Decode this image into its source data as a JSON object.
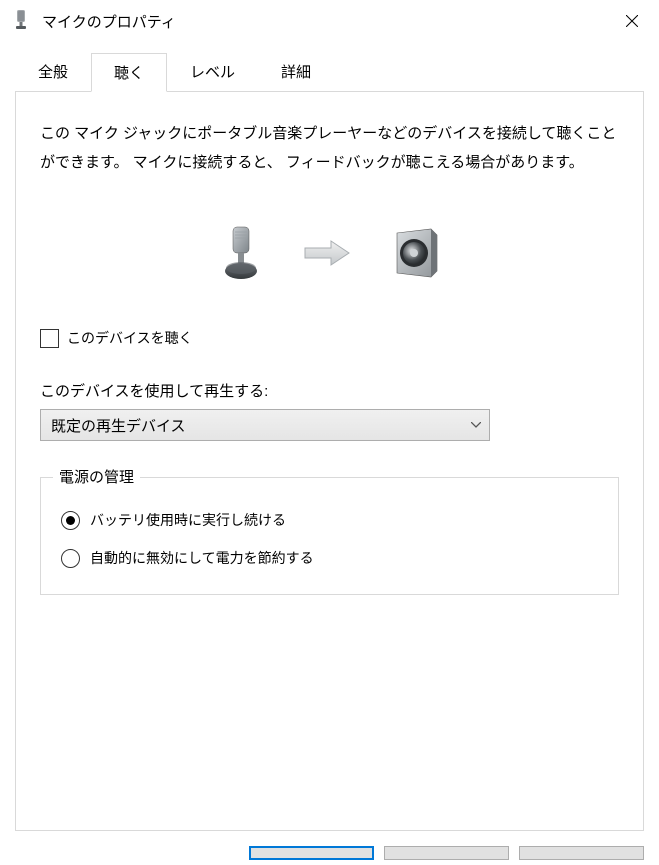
{
  "window": {
    "title": "マイクのプロパティ"
  },
  "tabs": {
    "general": "全般",
    "listen": "聴く",
    "level": "レベル",
    "advanced": "詳細"
  },
  "panel": {
    "description": "この マイク ジャックにポータブル音楽プレーヤーなどのデバイスを接続して聴くことができます。 マイクに接続すると、 フィードバックが聴こえる場合があります。",
    "listen_checkbox_label": "このデバイスを聴く",
    "playback_label": "このデバイスを使用して再生する:",
    "playback_selected": "既定の再生デバイス",
    "power_group_label": "電源の管理",
    "power_option_continue": "バッテリ使用時に実行し続ける",
    "power_option_disable": "自動的に無効にして電力を節約する"
  }
}
